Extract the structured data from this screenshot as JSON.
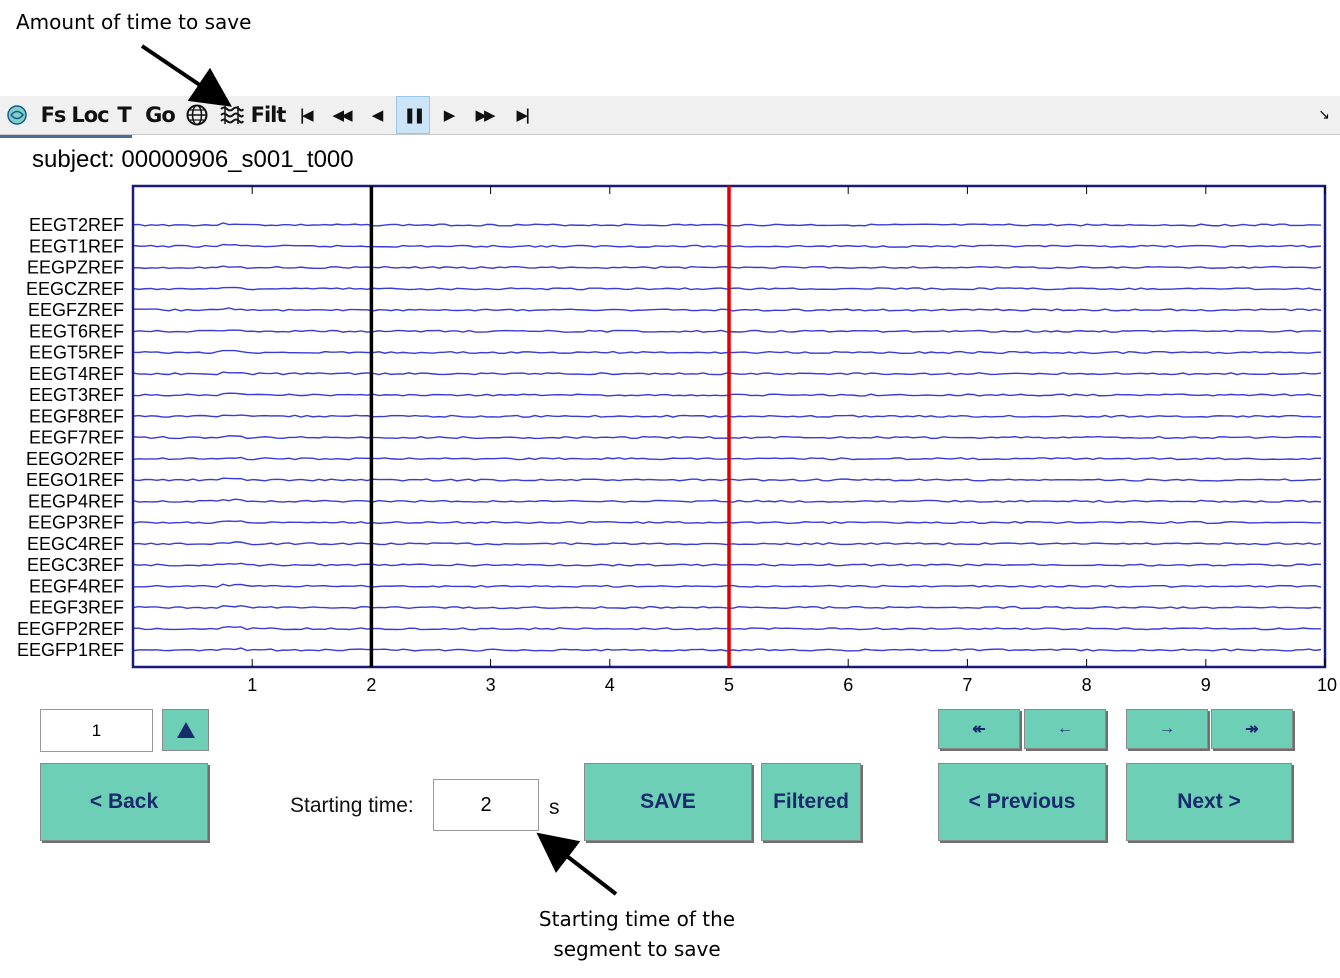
{
  "annotations": {
    "top": "Amount of time to save",
    "bottom_line1": "Starting time of the",
    "bottom_line2": "segment to save"
  },
  "toolbar": {
    "items": [
      {
        "name": "brain-icon",
        "label": "",
        "icon": "brain-icon"
      },
      {
        "name": "fs-button",
        "label": "Fs"
      },
      {
        "name": "loc-button",
        "label": "Loc"
      },
      {
        "name": "t-button",
        "label": "T"
      },
      {
        "name": "go-button",
        "label": "Go"
      },
      {
        "name": "globe-icon",
        "label": "",
        "icon": "globe-icon"
      },
      {
        "name": "waves-icon",
        "label": "",
        "icon": "waves-icon"
      },
      {
        "name": "filt-button",
        "label": "Filt"
      },
      {
        "name": "first-icon",
        "label": "|◀",
        "icon": "skip-to-start-icon"
      },
      {
        "name": "rewind-icon",
        "label": "◀◀",
        "icon": "rewind-icon"
      },
      {
        "name": "step-back-icon",
        "label": "◀",
        "icon": "step-back-icon"
      },
      {
        "name": "pause-icon",
        "label": "❚❚",
        "icon": "pause-icon",
        "active": true
      },
      {
        "name": "play-icon",
        "label": "▶",
        "icon": "play-icon"
      },
      {
        "name": "fast-forward-icon",
        "label": "▶▶",
        "icon": "fast-forward-icon"
      },
      {
        "name": "last-icon",
        "label": "▶|",
        "icon": "skip-to-end-icon"
      }
    ],
    "corner_icon": "↘"
  },
  "subject": {
    "label": "subject:",
    "value": "00000906_s001_t000"
  },
  "plot": {
    "channels": [
      "EEGT2REF",
      "EEGT1REF",
      "EEGPZREF",
      "EEGCZREF",
      "EEGFZREF",
      "EEGT6REF",
      "EEGT5REF",
      "EEGT4REF",
      "EEGT3REF",
      "EEGF8REF",
      "EEGF7REF",
      "EEGO2REF",
      "EEGO1REF",
      "EEGP4REF",
      "EEGP3REF",
      "EEGC4REF",
      "EEGC3REF",
      "EEGF4REF",
      "EEGF3REF",
      "EEGFP2REF",
      "EEGFP1REF"
    ],
    "x_ticks": [
      "1",
      "2",
      "3",
      "4",
      "5",
      "6",
      "7",
      "8",
      "9",
      "10"
    ],
    "x_range": [
      0,
      10
    ],
    "markers": [
      {
        "name": "start-marker",
        "time": 2,
        "color": "#000000"
      },
      {
        "name": "end-marker",
        "time": 5,
        "color": "#e00000"
      }
    ],
    "trace_color": "#3a3ad8",
    "frame_color": "#1a1a7a"
  },
  "controls": {
    "page_value": "1",
    "up_icon": "triangle-up-icon",
    "back_label": "<  Back",
    "starting_time_label": "Starting time:",
    "starting_time_value": "2",
    "starting_time_unit": "s",
    "save_label": "SAVE",
    "filtered_label": "Filtered",
    "nav_small": [
      {
        "name": "jump-start-button",
        "label": "↞"
      },
      {
        "name": "step-left-button",
        "label": "←"
      },
      {
        "name": "step-right-button",
        "label": "→"
      },
      {
        "name": "jump-end-button",
        "label": "↠"
      }
    ],
    "previous_label": "< Previous",
    "next_label": "Next  >",
    "accent_color": "#6ecfb7",
    "text_color": "#1a2b6d"
  }
}
